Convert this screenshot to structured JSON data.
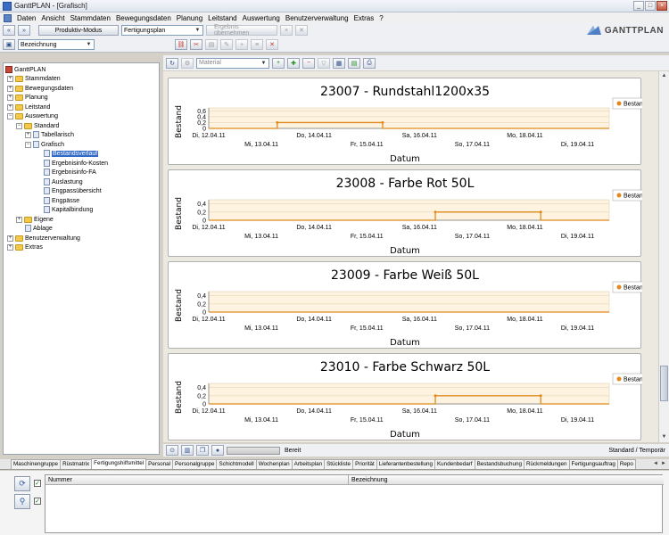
{
  "window": {
    "title": "GanttPLAN - [Grafisch]"
  },
  "menu": [
    "Daten",
    "Ansicht",
    "Stammdaten",
    "Bewegungsdaten",
    "Planung",
    "Leitstand",
    "Auswertung",
    "Benutzerverwaltung",
    "Extras",
    "?"
  ],
  "toolbar": {
    "mode_button": "Produktiv-Modus",
    "plan_select": "Fertigungsplan",
    "apply_button": "Ergebnis übernehmen",
    "filter_select": "Bezeichnung"
  },
  "brand": {
    "name": "GANTTPLAN"
  },
  "tree": {
    "root": "GanttPLAN",
    "items": [
      {
        "label": "Stammdaten"
      },
      {
        "label": "Bewegungsdaten"
      },
      {
        "label": "Planung"
      },
      {
        "label": "Leitstand"
      },
      {
        "label": "Auswertung"
      },
      {
        "label": "Standard"
      },
      {
        "label": "Tabellarisch"
      },
      {
        "label": "Grafisch"
      },
      {
        "label": "Bestandsverlauf"
      },
      {
        "label": "Ergebnisinfo-Kosten"
      },
      {
        "label": "Ergebnisinfo-FA"
      },
      {
        "label": "Auslastung"
      },
      {
        "label": "Engpassübersicht"
      },
      {
        "label": "Engpässe"
      },
      {
        "label": "Kapitalbindung"
      },
      {
        "label": "Eigene"
      },
      {
        "label": "Ablage"
      },
      {
        "label": "Benutzerverwaltung"
      },
      {
        "label": "Extras"
      }
    ]
  },
  "chart_toolbar": {
    "material_select": "Material"
  },
  "chart_data": [
    {
      "type": "line",
      "title": "23007 - Rundstahl1200x35",
      "xlabel": "Datum",
      "ylabel": "Bestand",
      "ylim": [
        0,
        0.7
      ],
      "yticks": [
        "0,6",
        "0,4",
        "0,2",
        "0"
      ],
      "x_upper": [
        "Di, 12.04.11",
        "Do, 14.04.11",
        "Sa, 16.04.11",
        "Mo, 18.04.11"
      ],
      "x_lower": [
        "Mi, 13.04.11",
        "Fr, 15.04.11",
        "So, 17.04.11",
        "Di, 19.04.11"
      ],
      "series": [
        {
          "name": "Bestand",
          "step_from": 13.3,
          "step_to": 15.3,
          "value": 0.2
        }
      ],
      "color": "#e08a1e"
    },
    {
      "type": "line",
      "title": "23008 - Farbe Rot 50L",
      "xlabel": "Datum",
      "ylabel": "Bestand",
      "ylim": [
        0,
        0.5
      ],
      "yticks": [
        "0,4",
        "0,2",
        "0"
      ],
      "x_upper": [
        "Di, 12.04.11",
        "Do, 14.04.11",
        "Sa, 16.04.11",
        "Mo, 18.04.11"
      ],
      "x_lower": [
        "Mi, 13.04.11",
        "Fr, 15.04.11",
        "So, 17.04.11",
        "Di, 19.04.11"
      ],
      "series": [
        {
          "name": "Bestand",
          "step_from": 16.3,
          "step_to": 18.3,
          "value": 0.2
        }
      ],
      "color": "#e08a1e"
    },
    {
      "type": "line",
      "title": "23009 - Farbe Weiß 50L",
      "xlabel": "Datum",
      "ylabel": "Bestand",
      "ylim": [
        0,
        0.5
      ],
      "yticks": [
        "0,4",
        "0,2",
        "0"
      ],
      "x_upper": [
        "Di, 12.04.11",
        "Do, 14.04.11",
        "Sa, 16.04.11",
        "Mo, 18.04.11"
      ],
      "x_lower": [
        "Mi, 13.04.11",
        "Fr, 15.04.11",
        "So, 17.04.11",
        "Di, 19.04.11"
      ],
      "series": [
        {
          "name": "Bestand",
          "step_from": null,
          "step_to": null,
          "value": 0
        }
      ],
      "color": "#e08a1e"
    },
    {
      "type": "line",
      "title": "23010 - Farbe Schwarz 50L",
      "xlabel": "Datum",
      "ylabel": "Bestand",
      "ylim": [
        0,
        0.5
      ],
      "yticks": [
        "0,4",
        "0,2",
        "0"
      ],
      "x_upper": [
        "Di, 12.04.11",
        "Do, 14.04.11",
        "Sa, 16.04.11",
        "Mo, 18.04.11"
      ],
      "x_lower": [
        "Mi, 13.04.11",
        "Fr, 15.04.11",
        "So, 17.04.11",
        "Di, 19.04.11"
      ],
      "series": [
        {
          "name": "Bestand",
          "step_from": 16.3,
          "step_to": 18.3,
          "value": 0.2
        }
      ],
      "color": "#e08a1e"
    }
  ],
  "status": {
    "text": "Bereit",
    "mode": "Standard / Temporär"
  },
  "bottom_tabs": [
    "Maschinengruppe",
    "Rüstmatrix",
    "Fertigungshilfsmittel",
    "Personal",
    "Personalgruppe",
    "Schichtmodell",
    "Wochenplan",
    "Arbeitsplan",
    "Stückliste",
    "Priorität",
    "Lieferantenbestellung",
    "Kundenbedarf",
    "Bestandsbuchung",
    "Rückmeldungen",
    "Fertigungsauftrag",
    "Repo"
  ],
  "active_tab": 2,
  "grid": {
    "columns": [
      "Nummer",
      "Bezeichnung"
    ]
  }
}
